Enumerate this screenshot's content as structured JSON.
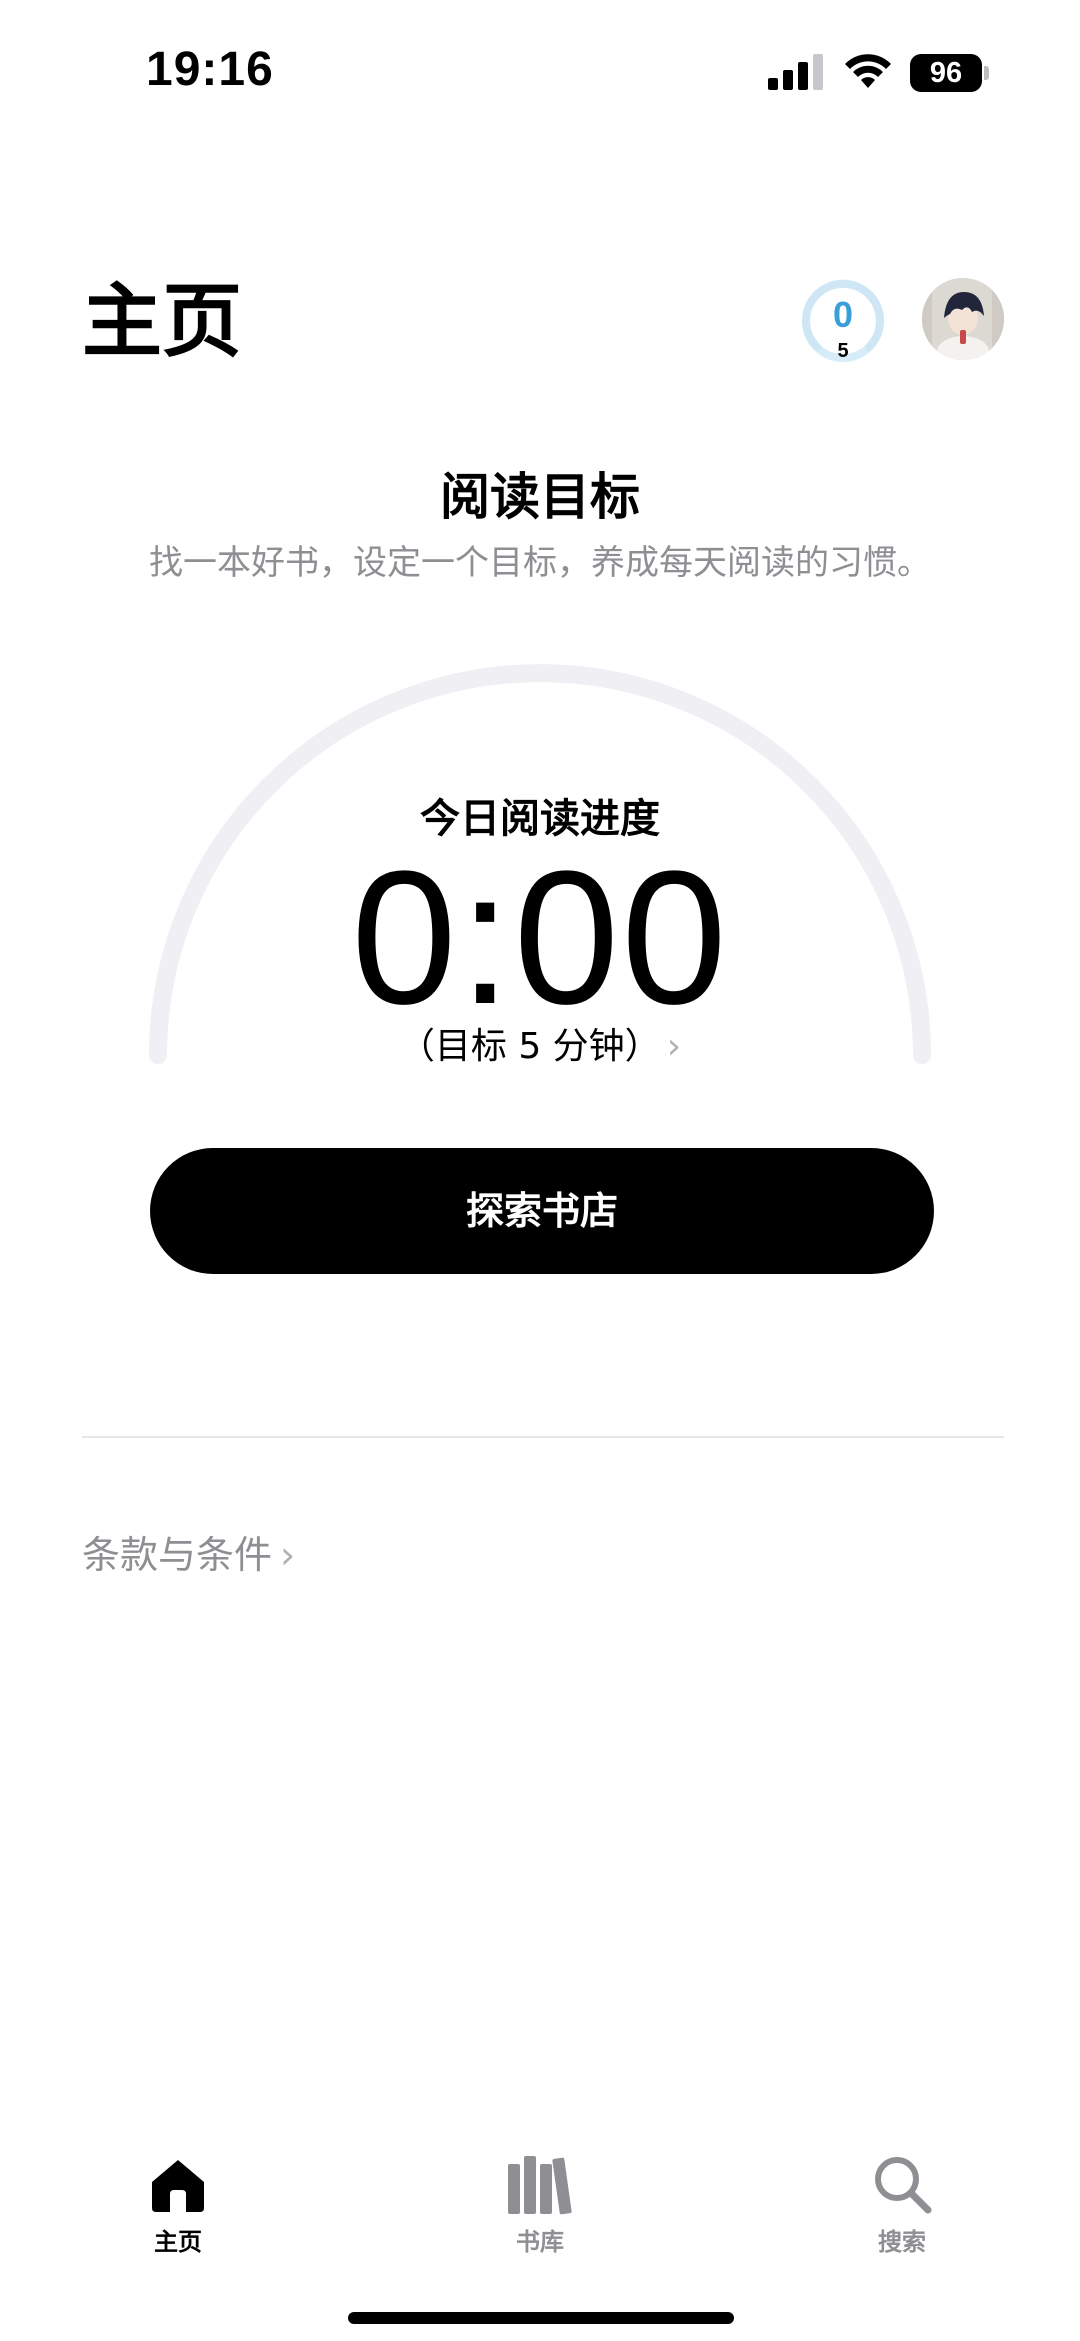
{
  "status_bar": {
    "time": "19:16",
    "battery_level": "96"
  },
  "header": {
    "title": "主页",
    "streak": {
      "count": "0",
      "goal": "5"
    }
  },
  "reading_goal": {
    "title": "阅读目标",
    "subtitle": "找一本好书，设定一个目标，养成每天阅读的习惯。",
    "progress_label": "今日阅读进度",
    "progress_time": "0:00",
    "progress_fraction": 0,
    "goal_text": "（目标 5 分钟）",
    "button_label": "探索书店"
  },
  "footer_links": {
    "terms": "条款与条件"
  },
  "tab_bar": {
    "tabs": [
      {
        "label": "主页",
        "icon": "house-icon",
        "active": true
      },
      {
        "label": "书库",
        "icon": "library-books-icon",
        "active": false
      },
      {
        "label": "搜索",
        "icon": "magnifier-icon",
        "active": false
      }
    ]
  },
  "colors": {
    "accent_blue": "#3a9fd8",
    "arc_track": "#f0f0f4",
    "secondary_text": "#8e8e93",
    "button_bg": "#000000"
  }
}
